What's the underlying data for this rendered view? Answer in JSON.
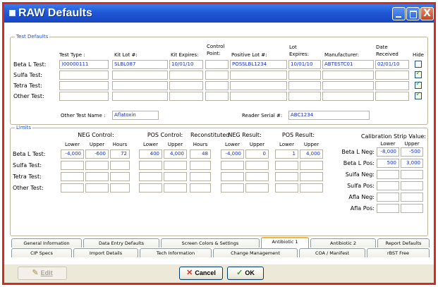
{
  "window": {
    "title": "RAW Defaults",
    "close_glyph": "X"
  },
  "test_defaults": {
    "group_label": "Test Defaults",
    "headers": {
      "test_type": "Test Type :",
      "kit_lot": "Kit Lot #:",
      "kit_expires": "Kit Expires:",
      "control_point_1": "Control",
      "control_point_2": "Point:",
      "positive_lot": "Positive Lot #:",
      "lot_expires_1": "Lot",
      "lot_expires_2": "Expires:",
      "manufacturer": "Manufacturer:",
      "date_received_1": "Date",
      "date_received_2": "Received",
      "hide": "Hide"
    },
    "rows": [
      {
        "label": "Beta L Test:",
        "test_type": ")00000111",
        "kit_lot": "SLBL087",
        "kit_expires": "10/01/10",
        "control_point": "",
        "positive_lot": "POSSLBL1234",
        "lot_expires": "10/01/10",
        "manufacturer": "ABTESTC01",
        "date_received": "02/01/10",
        "hide": false
      },
      {
        "label": "Sulfa Test:",
        "test_type": "",
        "kit_lot": "",
        "kit_expires": "",
        "control_point": "",
        "positive_lot": "",
        "lot_expires": "",
        "manufacturer": "",
        "date_received": "",
        "hide": true
      },
      {
        "label": "Tetra Test:",
        "test_type": "",
        "kit_lot": "",
        "kit_expires": "",
        "control_point": "",
        "positive_lot": "",
        "lot_expires": "",
        "manufacturer": "",
        "date_received": "",
        "hide": true
      },
      {
        "label": "Other Test:",
        "test_type": "",
        "kit_lot": "",
        "kit_expires": "",
        "control_point": "",
        "positive_lot": "",
        "lot_expires": "",
        "manufacturer": "",
        "date_received": "",
        "hide": true
      }
    ],
    "other_test_name_label": "Other Test Name :",
    "other_test_name": "Aflatoxin",
    "reader_serial_label": "Reader Serial #:",
    "reader_serial": "ABC1234"
  },
  "limits": {
    "group_label": "Limits",
    "neg_control": "NEG Control:",
    "pos_control": "POS Control:",
    "reconstituted": "Reconstituted",
    "neg_result": "NEG Result:",
    "pos_result": "POS Result:",
    "lower": "Lower",
    "upper": "Upper",
    "hours": "Hours",
    "rows": [
      {
        "label": "Beta L Test:",
        "neg_lower": "-4,000",
        "neg_upper": "-600",
        "neg_hours": "72",
        "pos_lower": "400",
        "pos_upper": "4,000",
        "recon_hours": "48",
        "negres_lower": "-4,000",
        "negres_upper": "0",
        "posres_lower": "1",
        "posres_upper": "4,000"
      },
      {
        "label": "Sulfa Test:",
        "neg_lower": "",
        "neg_upper": "",
        "neg_hours": "",
        "pos_lower": "",
        "pos_upper": "",
        "recon_hours": "",
        "negres_lower": "",
        "negres_upper": "",
        "posres_lower": "",
        "posres_upper": ""
      },
      {
        "label": "Tetra Test:",
        "neg_lower": "",
        "neg_upper": "",
        "neg_hours": "",
        "pos_lower": "",
        "pos_upper": "",
        "recon_hours": "",
        "negres_lower": "",
        "negres_upper": "",
        "posres_lower": "",
        "posres_upper": ""
      },
      {
        "label": "Other Test:",
        "neg_lower": "",
        "neg_upper": "",
        "neg_hours": "",
        "pos_lower": "",
        "pos_upper": "",
        "recon_hours": "",
        "negres_lower": "",
        "negres_upper": "",
        "posres_lower": "",
        "posres_upper": ""
      }
    ],
    "calibration": {
      "title": "Calibration Strip Value:",
      "lower": "Lower",
      "upper": "Upper",
      "rows": [
        {
          "label": "Beta L Neg:",
          "lower": "-8,000",
          "upper": "-500"
        },
        {
          "label": "Beta L Pos:",
          "lower": "500",
          "upper": "3,000"
        },
        {
          "label": "Sulfa Neg:",
          "lower": "",
          "upper": ""
        },
        {
          "label": "Sulfa Pos:",
          "lower": "",
          "upper": ""
        },
        {
          "label": "Afla Neg:",
          "lower": "",
          "upper": ""
        },
        {
          "label": "Afla Pos:",
          "lower": "",
          "upper": ""
        }
      ]
    }
  },
  "tabs_row1": [
    "General Information",
    "Data Entry Defaults",
    "Screen Colors & Settings",
    "Antibiotic 1",
    "Antibiotic 2",
    "Report Defaults"
  ],
  "tabs_row2": [
    "CIP Specs",
    "Import Details",
    "Tech Information",
    "Change Management",
    "COA / Manifest",
    "rBST Free"
  ],
  "active_tab": "Antibiotic 1",
  "buttons": {
    "edit": "Edit",
    "cancel": "Cancel",
    "ok": "OK"
  },
  "icons": {
    "title": "window-icon",
    "edit": "pencil-icon",
    "cancel": "red-x-icon",
    "ok": "green-check-icon"
  },
  "colors": {
    "title_bar": "#1f58d6",
    "frame": "#d42a1f",
    "field_text": "#1630c9",
    "group_title": "#1f4fd1",
    "active_tab_accent": "#f8b33a"
  }
}
